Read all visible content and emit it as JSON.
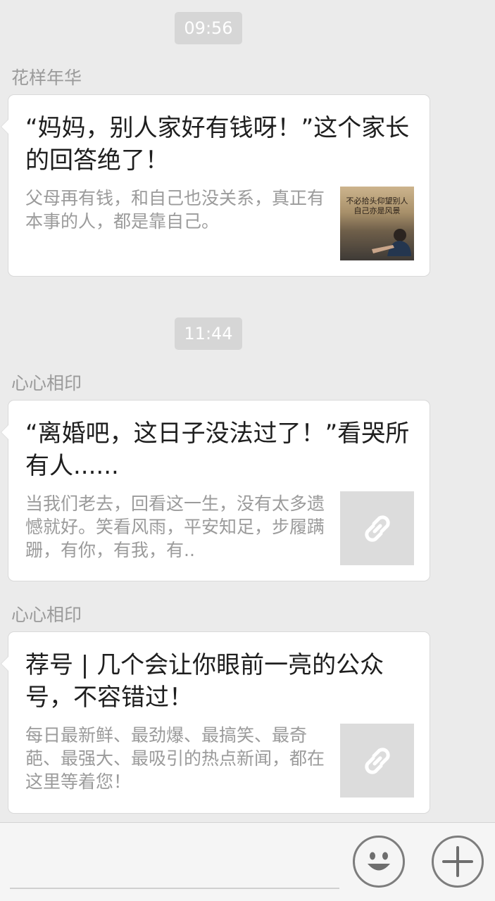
{
  "messages": [
    {
      "time": "09:56",
      "sender": "花样年华",
      "title": "“妈妈，别人家好有钱呀！”这个家长的回答绝了！",
      "description": "父母再有钱，和自己也没关系，真正有本事的人，都是靠自己。",
      "thumbnail": "photo",
      "thumbnail_caption": "不必拾头仰望别人 自己亦是风景"
    },
    {
      "time": "11:44",
      "sender": "心心相印",
      "title": "“离婚吧，这日子没法过了！”看哭所有人......",
      "description": "当我们老去，回看这一生，没有太多遗憾就好。笑看风雨，平安知足，步履蹒跚，有你，有我，有..",
      "thumbnail": "link-icon"
    },
    {
      "sender": "心心相印",
      "title": "荐号 | 几个会让你眼前一亮的公众号，不容错过！",
      "description": "每日最新鲜、最劲爆、最搞笑、最奇葩、最强大、最吸引的热点新闻，都在这里等着您！",
      "thumbnail": "link-icon"
    }
  ],
  "input_bar": {
    "emoji_button": "smiley-icon",
    "more_button": "plus-icon"
  },
  "colors": {
    "background": "#ebebeb",
    "card": "#ffffff",
    "secondary_text": "#9b9b9b",
    "time_chip": "#d6d6d6"
  }
}
